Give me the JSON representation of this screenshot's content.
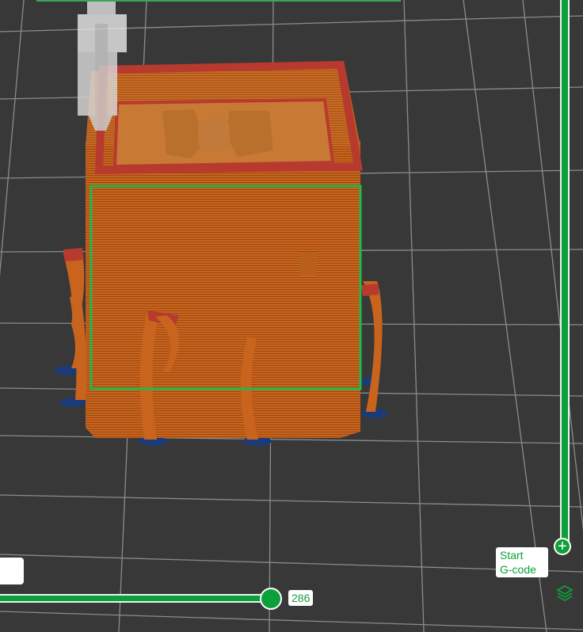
{
  "viewport": {
    "description_icon": "3d-print-preview",
    "colors": {
      "background": "#383838",
      "grid": "#9a9a9a",
      "model": "#c8641e",
      "model_top": "#b83a2f",
      "support_foot": "#1a3a7a",
      "selection": "#22b84a",
      "accent": "#0d9f3a"
    }
  },
  "vertical_slider": {
    "start_label": "Start\nG-code",
    "handle_icon": "plus-icon"
  },
  "horizontal_slider": {
    "value": "286"
  },
  "toolbar": {
    "layers_icon": "layers-icon"
  }
}
